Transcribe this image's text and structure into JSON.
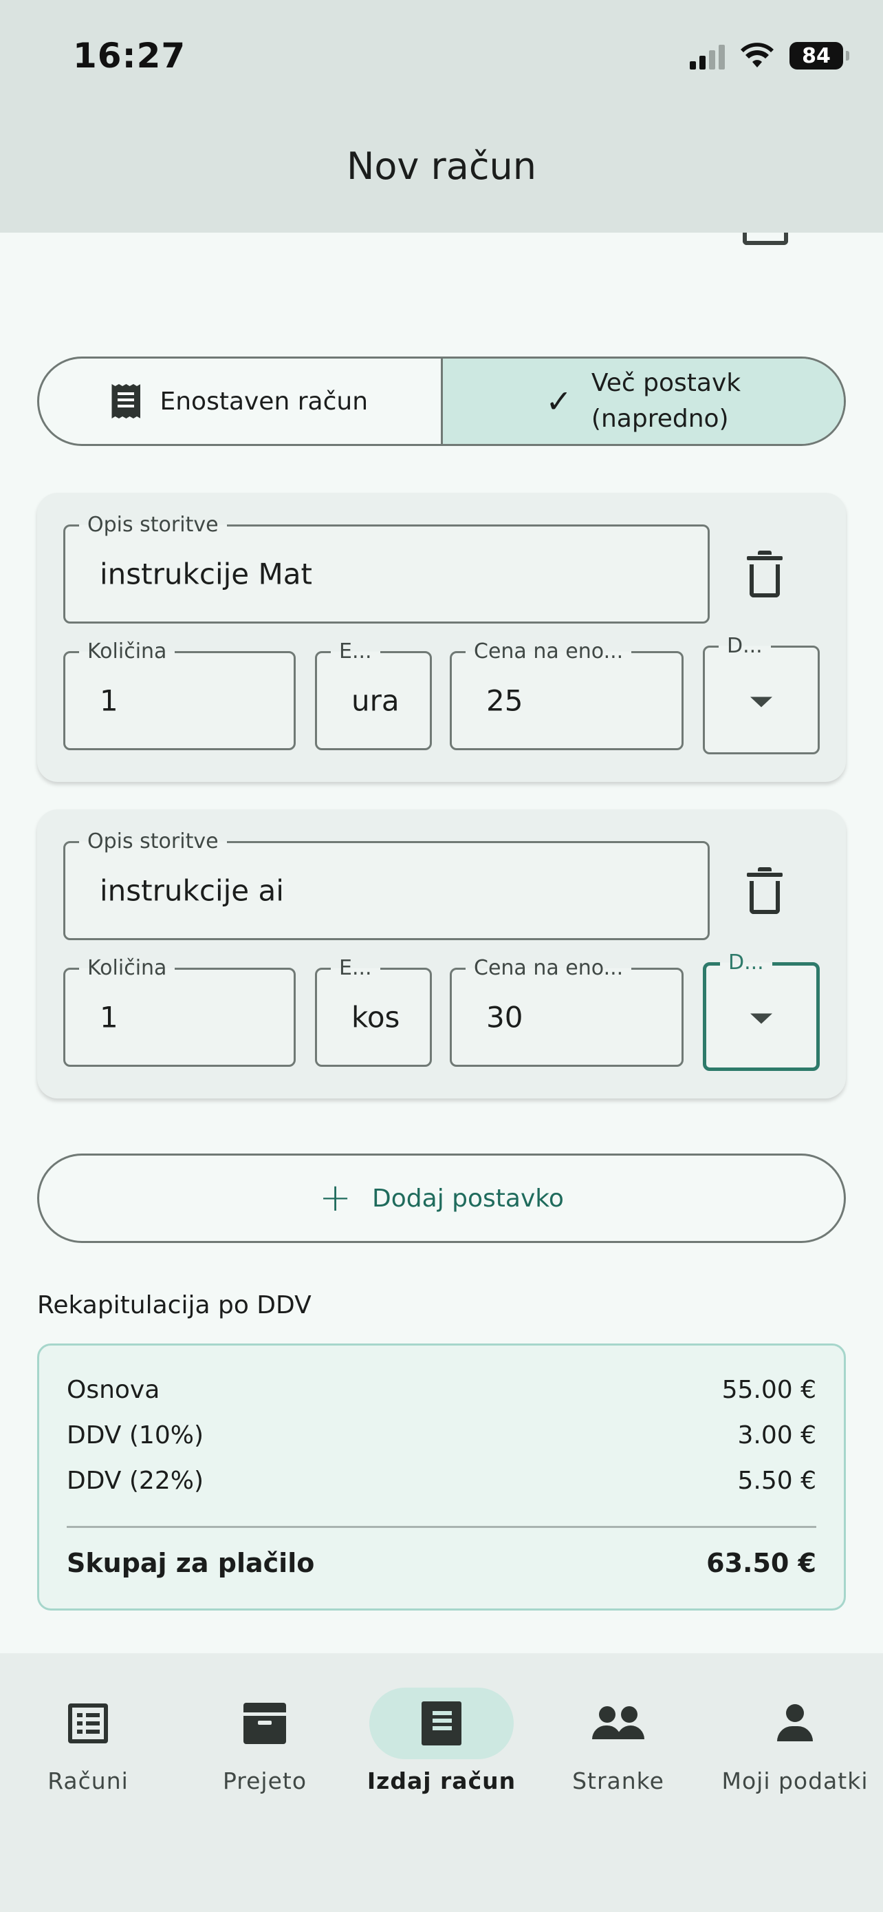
{
  "status_bar": {
    "time": "16:27",
    "battery": "84"
  },
  "header": {
    "title": "Nov račun"
  },
  "mode_toggle": {
    "simple_label": "Enostaven račun",
    "advanced_label_line1": "Več postavk",
    "advanced_label_line2": "(napredno)",
    "selected": "advanced"
  },
  "items": [
    {
      "description_label": "Opis storitve",
      "description_value": "instrukcije Mat",
      "quantity_label": "Količina",
      "quantity_value": "1",
      "unit_label": "E...",
      "unit_value": "ura",
      "price_label": "Cena na eno...",
      "price_value": "25",
      "vat_label": "D..."
    },
    {
      "description_label": "Opis storitve",
      "description_value": "instrukcije ai",
      "quantity_label": "Količina",
      "quantity_value": "1",
      "unit_label": "E...",
      "unit_value": "kos",
      "price_label": "Cena na eno...",
      "price_value": "30",
      "vat_label": "D..."
    }
  ],
  "add_item": {
    "label": "Dodaj postavko"
  },
  "recap": {
    "title": "Rekapitulacija po DDV",
    "rows": [
      {
        "label": "Osnova",
        "value": "55.00 €"
      },
      {
        "label": "DDV (10%)",
        "value": "3.00 €"
      },
      {
        "label": "DDV (22%)",
        "value": "5.50 €"
      }
    ],
    "total_label": "Skupaj za plačilo",
    "total_value": "63.50 €"
  },
  "bottom_nav": {
    "items": [
      {
        "label": "Računi",
        "icon": "list-icon"
      },
      {
        "label": "Prejeto",
        "icon": "archive-icon"
      },
      {
        "label": "Izdaj račun",
        "icon": "receipt-icon",
        "active": true
      },
      {
        "label": "Stranke",
        "icon": "people-icon"
      },
      {
        "label": "Moji podatki",
        "icon": "person-icon"
      }
    ]
  },
  "colors": {
    "accent": "#1f6b5c",
    "selected_bg": "#cde8e1",
    "header_bg": "#dae3e0"
  }
}
